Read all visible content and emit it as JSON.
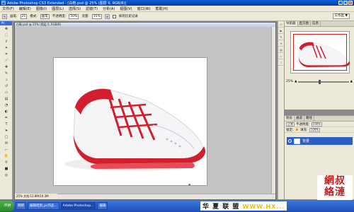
{
  "window": {
    "app_badge": "Ps",
    "title": "Adobe Photoshop CS3 Extended - [白鞋.psd @ 25% (图层 0, RGB/8)]"
  },
  "menu": [
    "文件(F)",
    "编辑(E)",
    "图像(I)",
    "图层(L)",
    "选择(S)",
    "滤镜(T)",
    "分析(A)",
    "视图(V)",
    "窗口(W)",
    "帮助(H)"
  ],
  "options": {
    "brush_label": "画笔:",
    "brush_size": "21",
    "mode_label": "模式:",
    "mode_value": "画笔",
    "opacity_label": "不透明度:",
    "opacity_value": "50%",
    "flow_label": "流量:",
    "flow_value": "15%",
    "history_label": "抹到历史记录",
    "workspace_label": "工作区 ▼"
  },
  "document": {
    "title": "白鞋.psd @ 25% (图层 0, RGB/8)",
    "zoom": "25%",
    "status": "文档:12.8M/10.3M"
  },
  "navigator": {
    "tabs": [
      "导航器",
      "直方图",
      "信息"
    ],
    "zoom": "25%"
  },
  "layers": {
    "tabs": [
      "图层",
      "通道",
      "路径"
    ],
    "blend_mode": "正常",
    "opacity_label": "不透明度:",
    "opacity_value": "100%",
    "lock_label": "锁定:",
    "fill_label": "填充:",
    "fill_value": "100%",
    "layer_name": "背景"
  },
  "taskbar": {
    "start_label": "开始",
    "tasks": [
      "网络",
      "编辑组别_ps作品...",
      "Adobe Photoshop...",
      "编辑"
    ]
  },
  "watermark": {
    "text": "华 夏 联 盟",
    "url": "WWW.HX...",
    "logo": "網綠\n叔漣"
  },
  "colors": {
    "accent": "#d0231e",
    "titlebar": "#0b3c9c"
  }
}
